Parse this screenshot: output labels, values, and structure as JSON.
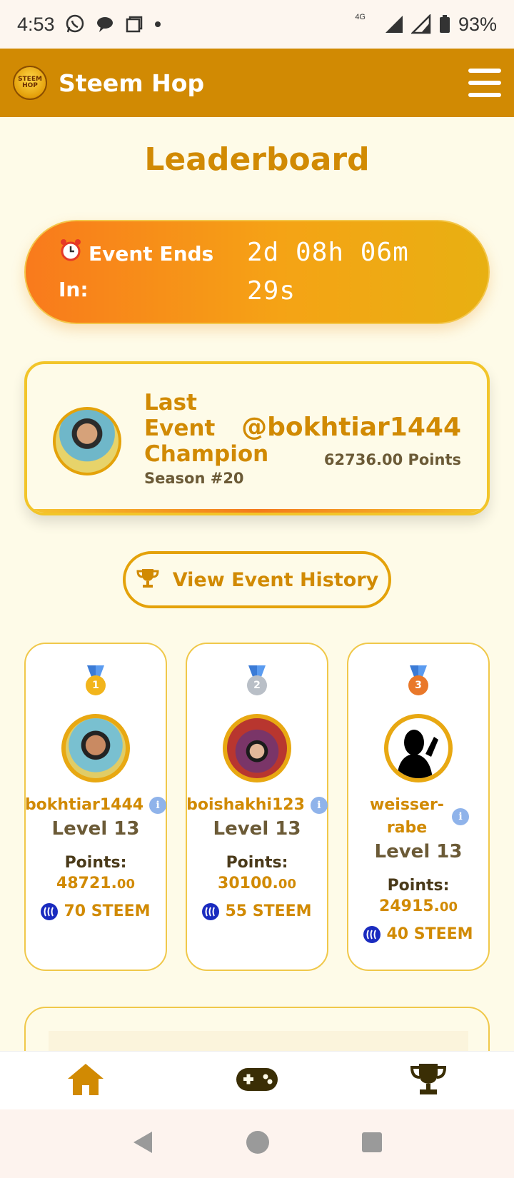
{
  "status_bar": {
    "time": "4:53",
    "network": "4G",
    "battery": "93%"
  },
  "app": {
    "title": "Steem Hop",
    "logo_text": "STEEM HOP"
  },
  "page": {
    "title": "Leaderboard"
  },
  "countdown": {
    "icon": "alarm-clock-icon",
    "label": "Event Ends In:",
    "value": "2d 08h 06m 29s"
  },
  "champion": {
    "title": "Last Event Champion",
    "season": "Season #20",
    "username": "@bokhtiar1444",
    "points": "62736.00 Points"
  },
  "history_button": {
    "label": "View Event History",
    "icon": "trophy-icon"
  },
  "podium": [
    {
      "rank": "1",
      "medal_color": "#f2b51c",
      "username": "bokhtiar1444",
      "level": "Level 13",
      "points_label": "Points:",
      "points": "48721.",
      "points_decimals": "00",
      "reward": "70 STEEM"
    },
    {
      "rank": "2",
      "medal_color": "#b9bfc7",
      "username": "boishakhi123",
      "level": "Level 13",
      "points_label": "Points:",
      "points": "30100.",
      "points_decimals": "00",
      "reward": "55 STEEM"
    },
    {
      "rank": "3",
      "medal_color": "#e9782a",
      "username": "weisser-rabe",
      "level": "Level 13",
      "points_label": "Points:",
      "points": "24915.",
      "points_decimals": "00",
      "reward": "40 STEEM"
    }
  ],
  "colors": {
    "brand": "#d18a03",
    "background": "#fefbe8",
    "accent_gradient_start": "#f97a1c",
    "accent_gradient_end": "#e8b012"
  },
  "bottom_nav": [
    {
      "icon": "home-icon",
      "active": true
    },
    {
      "icon": "gamepad-icon",
      "active": false
    },
    {
      "icon": "trophy-icon",
      "active": false
    }
  ]
}
